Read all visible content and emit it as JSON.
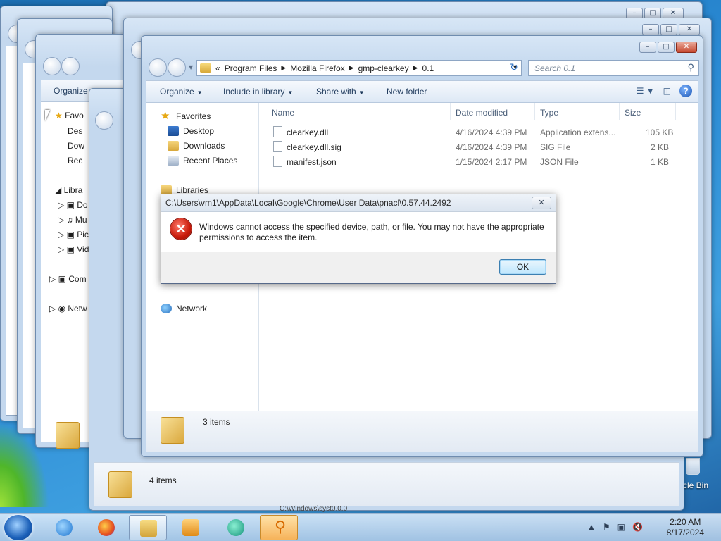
{
  "desktop": {
    "recycle_bin_label": "cle Bin"
  },
  "background_windows": {
    "organize_label": "Organize",
    "nav_partial": [
      "Favo",
      "Des",
      "Dow",
      "Rec",
      "Libra",
      "Do",
      "Mu",
      "Pic",
      "Vid",
      "Com",
      "Netw"
    ],
    "status_items": "4 items",
    "bottom_partial": "C:\\Windows\\syst0.0.0"
  },
  "window": {
    "breadcrumb": [
      "Program Files",
      "Mozilla Firefox",
      "gmp-clearkey",
      "0.1"
    ],
    "breadcrumb_prefix": "«",
    "search_placeholder": "Search 0.1",
    "toolbar": {
      "organize": "Organize",
      "include_in_library": "Include in library",
      "share_with": "Share with",
      "new_folder": "New folder"
    },
    "nav": {
      "favorites": "Favorites",
      "desktop": "Desktop",
      "downloads": "Downloads",
      "recent_places": "Recent Places",
      "libraries": "Libraries",
      "network": "Network"
    },
    "columns": {
      "name": "Name",
      "date_modified": "Date modified",
      "type": "Type",
      "size": "Size"
    },
    "files": [
      {
        "name": "clearkey.dll",
        "date": "4/16/2024 4:39 PM",
        "type": "Application extens...",
        "size": "105 KB"
      },
      {
        "name": "clearkey.dll.sig",
        "date": "4/16/2024 4:39 PM",
        "type": "SIG File",
        "size": "2 KB"
      },
      {
        "name": "manifest.json",
        "date": "1/15/2024 2:17 PM",
        "type": "JSON File",
        "size": "1 KB"
      }
    ],
    "status": "3 items"
  },
  "dialog": {
    "title": "C:\\Users\\vm1\\AppData\\Local\\Google\\Chrome\\User Data\\pnacl\\0.57.44.2492",
    "message": "Windows cannot access the specified device, path, or file.  You may not have the appropriate permissions to access the item.",
    "ok": "OK"
  },
  "taskbar": {
    "time": "2:20 AM",
    "date": "8/17/2024"
  }
}
